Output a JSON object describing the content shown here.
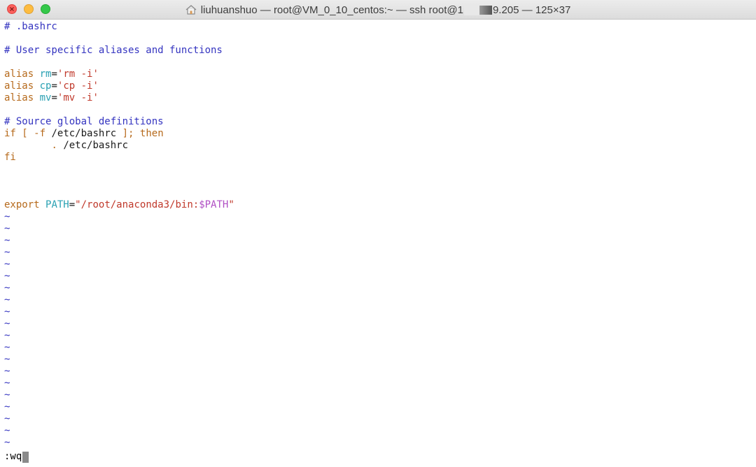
{
  "window": {
    "title_prefix": "liuhuanshuo — root@VM_0_10_centos:~ — ssh root@1",
    "title_redacted": "",
    "title_suffix": "9.205 — 125×37",
    "title_icon": "home-icon",
    "colors": {
      "close": "#fc605c",
      "minimize": "#fdbc40",
      "zoom": "#34c84a"
    }
  },
  "editor": {
    "lines": {
      "l1": "# .bashrc",
      "l2": "",
      "l3": "# User specific aliases and functions",
      "l4": "",
      "l5_kw": "alias",
      "l5_name": "rm",
      "l5_eq": "=",
      "l5_val": "'rm -i'",
      "l6_kw": "alias",
      "l6_name": "cp",
      "l6_eq": "=",
      "l6_val": "'cp -i'",
      "l7_kw": "alias",
      "l7_name": "mv",
      "l7_eq": "=",
      "l7_val": "'mv -i'",
      "l8": "",
      "l9": "# Source global definitions",
      "l10_if": "if",
      "l10_open": "[",
      "l10_flag": "-f",
      "l10_path": "/etc/bashrc",
      "l10_close": "];",
      "l10_then": "then",
      "l11_dot": ".",
      "l11_path": "/etc/bashrc",
      "l12": "fi",
      "l16_export": "export",
      "l16_name": "PATH",
      "l16_eq": "=",
      "l16_str": "\"/root/anaconda3/bin:",
      "l16_var": "$PATH",
      "l16_end": "\""
    },
    "tilde": "~",
    "tilde_count": 20,
    "command": ":wq",
    "colors": {
      "comment": "#3434c0",
      "statement": "#b66a1c",
      "identifier": "#2aa1b3",
      "string": "#c0392b",
      "variable": "#b04fc4"
    }
  }
}
